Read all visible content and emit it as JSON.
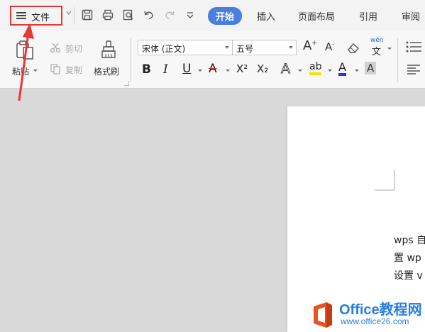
{
  "toolbar": {
    "file_label": "文件",
    "tabs": [
      {
        "label": "开始",
        "active": true
      },
      {
        "label": "插入",
        "active": false
      },
      {
        "label": "页面布局",
        "active": false
      },
      {
        "label": "引用",
        "active": false
      },
      {
        "label": "审阅",
        "active": false
      }
    ],
    "quick_access_icons": [
      "save-icon",
      "print-icon",
      "print-preview-icon",
      "undo-icon",
      "redo-icon",
      "customize-icon"
    ]
  },
  "ribbon": {
    "clipboard": {
      "paste_label": "粘贴",
      "cut_label": "剪切",
      "copy_label": "复制",
      "format_painter_label": "格式刷"
    },
    "font": {
      "font_family_value": "宋体 (正文)",
      "font_size_value": "五号",
      "grow_glyph": "A",
      "shrink_glyph": "A",
      "phonetic_glyph": "wén",
      "phonetic_char": "文",
      "bold_glyph": "B",
      "italic_glyph": "I",
      "underline_glyph": "U",
      "strike_glyph": "A",
      "superscript_glyph": "X²",
      "subscript_glyph": "X₂",
      "text_effect_glyph": "A",
      "highlight_glyph": "ab",
      "font_color_glyph": "A",
      "char_shading_glyph": "A"
    },
    "colors": {
      "highlight": "#f2e600",
      "font_color": "#1f37d6",
      "strike": "#e02020"
    }
  },
  "document": {
    "lines": [
      "wps 自",
      "置 wp",
      "设置 v"
    ]
  },
  "watermark": {
    "brand": "Office教程网",
    "url": "www.office26.com"
  },
  "annotation": {
    "color": "#e53935"
  }
}
